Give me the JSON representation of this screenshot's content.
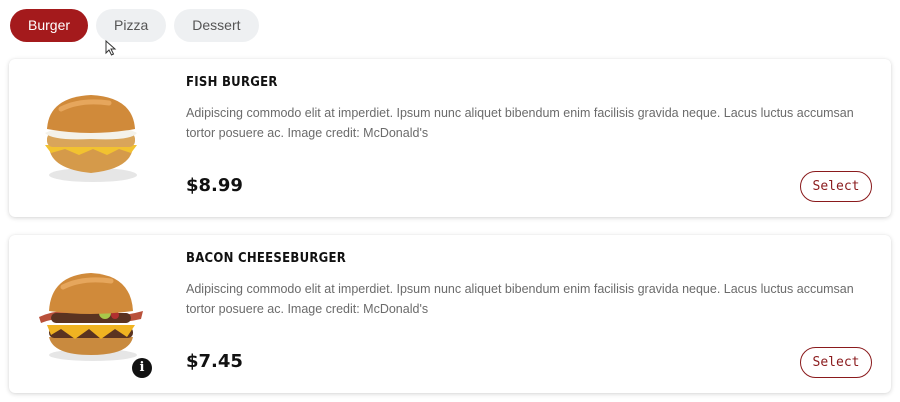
{
  "tabs": [
    {
      "label": "Burger",
      "active": true
    },
    {
      "label": "Pizza",
      "active": false
    },
    {
      "label": "Dessert",
      "active": false
    }
  ],
  "products": [
    {
      "name": "FISH BURGER",
      "description": "Adipiscing commodo elit at imperdiet. Ipsum nunc aliquet bibendum enim facilisis gravida neque. Lacus luctus accumsan tortor posuere ac. Image credit: McDonald's",
      "price": "$8.99",
      "button_label": "Select"
    },
    {
      "name": "BACON CHEESEBURGER",
      "description": "Adipiscing commodo elit at imperdiet. Ipsum nunc aliquet bibendum enim facilisis gravida neque. Lacus luctus accumsan tortor posuere ac. Image credit: McDonald's",
      "price": "$7.45",
      "button_label": "Select"
    }
  ],
  "info_icon_glyph": "i",
  "colors": {
    "accent": "#a41a1c",
    "tab_inactive_bg": "#eef0f2",
    "select_border": "#8a1a1c"
  }
}
